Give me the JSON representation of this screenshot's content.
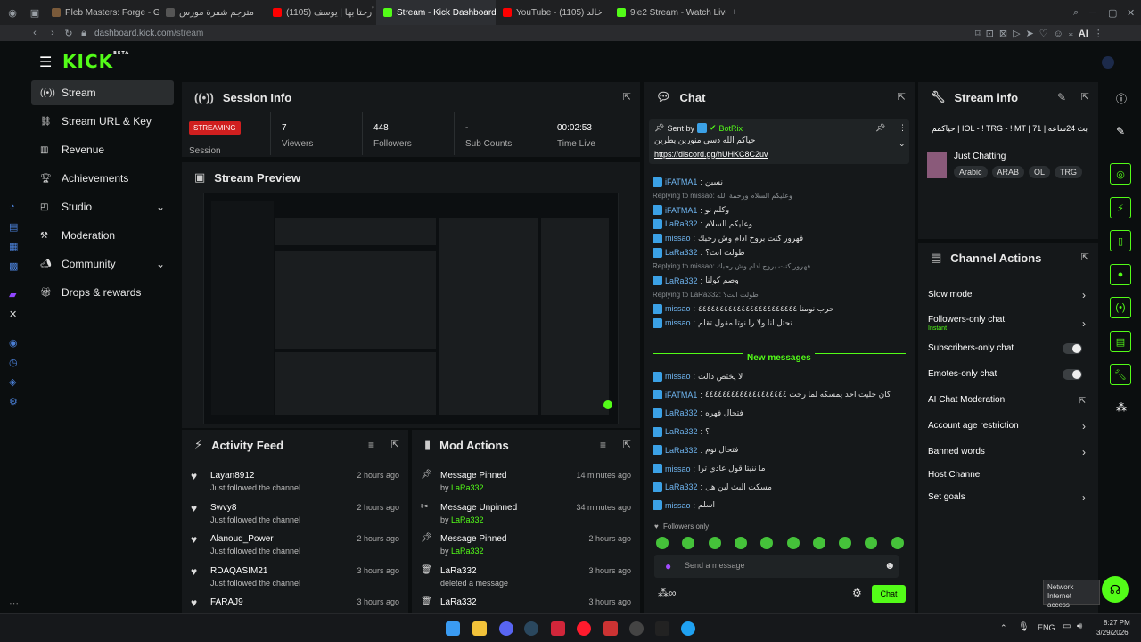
{
  "browser": {
    "tabs": [
      {
        "label": "Pleb Masters: Forge - GTA",
        "active": false,
        "color": "#7a5a3a"
      },
      {
        "label": "مترجم شفرة مورس",
        "active": false,
        "color": "#555555"
      },
      {
        "label": "(1105) أرحتا بها | يوسف",
        "active": false,
        "color": "#ff0000"
      },
      {
        "label": "Stream - Kick Dashboard",
        "active": true,
        "color": "#53fc18"
      },
      {
        "label": "YouTube - خالد (1105)",
        "active": false,
        "color": "#ff0000"
      },
      {
        "label": "9le2 Stream - Watch Live",
        "active": false,
        "color": "#53fc18"
      }
    ],
    "url_domain": "dashboard.kick.com",
    "url_path": "/stream",
    "ai_label": "AI"
  },
  "brand": {
    "logo": "KICK",
    "badge": "BETA",
    "accent": "#53fc18"
  },
  "sidebar": {
    "items": [
      {
        "label": "Stream",
        "icon": "broadcast-icon",
        "active": true
      },
      {
        "label": "Stream URL & Key",
        "icon": "link-icon"
      },
      {
        "label": "Revenue",
        "icon": "chart-icon"
      },
      {
        "label": "Achievements",
        "icon": "trophy-icon"
      },
      {
        "label": "Studio",
        "icon": "layers-icon",
        "expand": true
      },
      {
        "label": "Moderation",
        "icon": "hammer-icon"
      },
      {
        "label": "Community",
        "icon": "megaphone-icon",
        "expand": true
      },
      {
        "label": "Drops & rewards",
        "icon": "gift-icon"
      }
    ]
  },
  "session": {
    "title": "Session Info",
    "status": "STREAMING",
    "status_label": "Session",
    "stats": [
      {
        "value": "7",
        "label": "Viewers"
      },
      {
        "value": "448",
        "label": "Followers"
      },
      {
        "value": "-",
        "label": "Sub Counts"
      },
      {
        "value": "00:02:53",
        "label": "Time Live"
      }
    ]
  },
  "preview": {
    "title": "Stream Preview"
  },
  "activity": {
    "title": "Activity Feed",
    "items": [
      {
        "name": "Layan8912",
        "text": "Just followed the channel",
        "time": "2 hours ago"
      },
      {
        "name": "Swvy8",
        "text": "Just followed the channel",
        "time": "2 hours ago"
      },
      {
        "name": "Alanoud_Power",
        "text": "Just followed the channel",
        "time": "2 hours ago"
      },
      {
        "name": "RDAQASIM21",
        "text": "Just followed the channel",
        "time": "3 hours ago"
      },
      {
        "name": "FARAJ9",
        "text": "",
        "time": "3 hours ago"
      }
    ]
  },
  "modactions": {
    "title": "Mod Actions",
    "by_prefix": "by",
    "items": [
      {
        "name": "Message Pinned",
        "by": "LaRa332",
        "time": "14 minutes ago",
        "icon": "pin-icon"
      },
      {
        "name": "Message Unpinned",
        "by": "LaRa332",
        "time": "34 minutes ago",
        "icon": "unpin-icon"
      },
      {
        "name": "Message Pinned",
        "by": "LaRa332",
        "time": "2 hours ago",
        "icon": "pin-icon"
      },
      {
        "name": "LaRa332",
        "by": "",
        "sub": "deleted a message",
        "time": "3 hours ago",
        "icon": "trash-icon"
      },
      {
        "name": "LaRa332",
        "by": "",
        "sub": "",
        "time": "3 hours ago",
        "icon": "trash-icon"
      }
    ]
  },
  "chat": {
    "title": "Chat",
    "pinned": {
      "sent_by": "Sent by",
      "bot": "BotRix",
      "text": "حياكم الله دسي منورين يطرين",
      "link": "https://discord.gg/hUHKC8C2uv"
    },
    "lines": [
      {
        "user": "iFATMA1",
        "msg": "نسين"
      },
      {
        "reply": "Replying to missao: وعليكم السلام ورحمة الله"
      },
      {
        "user": "iFATMA1",
        "msg": "وكلم نو"
      },
      {
        "user": "LaRa332",
        "msg": "وعليكم السلام"
      },
      {
        "user": "missao",
        "msg": "فهرور كنت بروح ادام وش رحبك"
      },
      {
        "user": "LaRa332",
        "msg": "طولت انت؟"
      },
      {
        "reply": "Replying to missao: فهرور كنت بروح ادام وش رحبك"
      },
      {
        "user": "LaRa332",
        "msg": "وصم كولنا"
      },
      {
        "reply": "Replying to LaRa332: طولت انت؟"
      },
      {
        "user": "missao",
        "msg": "حرب نومنا ٤٤٤٤٤٤٤٤٤٤٤٤٤٤٤٤٤٤٤٤٤٤٤"
      },
      {
        "user": "missao",
        "msg": "تحتل انا ولا را نوتا مقول تقلم"
      }
    ],
    "new_messages": "New messages",
    "lines2": [
      {
        "user": "missao",
        "msg": "لا يختص دالت"
      },
      {
        "user": "iFATMA1",
        "msg": "كان حليت احد يمسكه لما رحت ٤٤٤٤٤٤٤٤٤٤٤٤٤٤٤٤٤٤٤"
      },
      {
        "user": "LaRa332",
        "msg": "فتحال فهره"
      },
      {
        "user": "LaRa332",
        "msg": "؟"
      },
      {
        "user": "LaRa332",
        "msg": "فتحال نوم"
      },
      {
        "user": "missao",
        "msg": "ما ننيتا قول عادي ترا"
      },
      {
        "user": "LaRa332",
        "msg": "مسكت البث لين هل"
      },
      {
        "user": "missao",
        "msg": "اسلم"
      }
    ],
    "followers_only": "Followers only",
    "input_placeholder": "Send a message",
    "send_label": "Chat"
  },
  "streaminfo": {
    "title": "Stream info",
    "stream_title": "بث 24ساعه | 71 | IOL - ! TRG - ! MT | حياكمم",
    "category": "Just Chatting",
    "tags": [
      "Arabic",
      "ARAB",
      "OL",
      "TRG"
    ]
  },
  "channelactions": {
    "title": "Channel Actions",
    "items": [
      {
        "label": "Slow mode",
        "kind": "chevron"
      },
      {
        "label": "Followers-only chat",
        "sub": "Instant",
        "kind": "chevron"
      },
      {
        "label": "Subscribers-only chat",
        "kind": "toggle"
      },
      {
        "label": "Emotes-only chat",
        "kind": "toggle"
      },
      {
        "label": "AI Chat Moderation",
        "kind": "external"
      },
      {
        "label": "Account age restriction",
        "kind": "chevron"
      },
      {
        "label": "Banned words",
        "kind": "chevron"
      },
      {
        "label": "Host Channel",
        "kind": "none"
      },
      {
        "label": "Set goals",
        "kind": "chevron"
      }
    ]
  },
  "taskbar": {
    "lang": "ENG",
    "time": "8:27 PM",
    "date": "3/29/2026",
    "tooltip_title": "Network",
    "tooltip_sub": "Internet access"
  }
}
